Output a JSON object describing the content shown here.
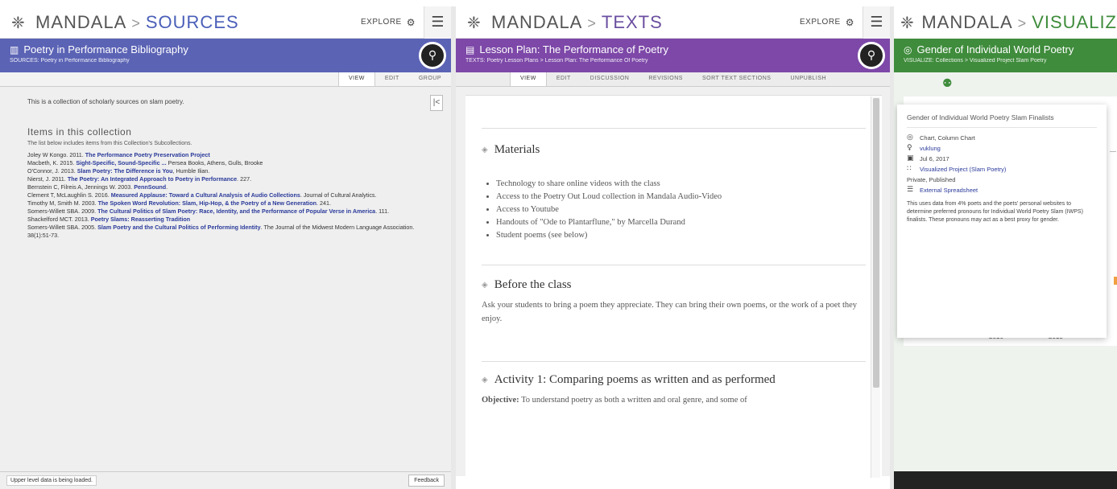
{
  "sources": {
    "brand": "MANDALA",
    "section": "SOURCES",
    "explore": "EXPLORE",
    "title": "Poetry in Performance Bibliography",
    "crumb": "SOURCES: Poetry in Performance Bibliography",
    "tabs": [
      "VIEW",
      "EDIT",
      "GROUP"
    ],
    "intro": "This is a collection of scholarly sources on slam poetry.",
    "items_heading": "Items in this collection",
    "items_sub": "The list below includes items from this Collection's Subcollections.",
    "items": [
      {
        "pre": "Joley W Kongo. 2011. ",
        "bold": "The Performance Poetry Preservation Project",
        "post": ""
      },
      {
        "pre": "Macbeth, K. 2015. ",
        "bold": "Sight-Specific, Sound-Specific ...",
        "post": " Persea Books, Athens, Gulls, Brooke"
      },
      {
        "pre": "O'Connor, J. 2013. ",
        "bold": "Slam Poetry: The Difference is You",
        "post": ", Humble Ilian."
      },
      {
        "pre": "Nierst, J. 2011. ",
        "bold": "The Poetry: An Integrated Approach to Poetry in Performance",
        "post": ". 227."
      },
      {
        "pre": "Bernstein C, Filreis A, Jennings W. 2003. ",
        "bold": "PennSound",
        "post": "."
      },
      {
        "pre": "Clement T, McLaughlin S. 2016. ",
        "bold": "Measured Applause: Toward a Cultural Analysis of Audio Collections",
        "post": ". Journal of Cultural Analytics."
      },
      {
        "pre": "Timothy M, Smith M. 2003. ",
        "bold": "The Spoken Word Revolution: Slam, Hip-Hop, & the Poetry of a New Generation",
        "post": ". 241."
      },
      {
        "pre": "Somers-Willett SBA. 2009. ",
        "bold": "The Cultural Politics of Slam Poetry: Race, Identity, and the Performance of Popular Verse in America",
        "post": ". 111."
      },
      {
        "pre": "Shackelford MCT. 2013. ",
        "bold": "Poetry Slams: Reasserting Tradition",
        "post": ""
      },
      {
        "pre": "Somers-Willett SBA. 2005. ",
        "bold": "Slam Poetry and the Cultural Politics of Performing Identity",
        "post": ". The Journal of the Midwest Modern Language Association. 38(1):51-73."
      }
    ],
    "footer_msg": "Upper level data is being loaded.",
    "footer_btn": "Feedback"
  },
  "texts": {
    "brand": "MANDALA",
    "section": "TEXTS",
    "explore": "EXPLORE",
    "title": "Lesson Plan: The Performance of Poetry",
    "crumb": "TEXTS: Poetry Lesson Plans > Lesson Plan: The Performance Of Poetry",
    "tabs": [
      "VIEW",
      "EDIT",
      "DISCUSSION",
      "REVISIONS",
      "SORT TEXT SECTIONS",
      "UNPUBLISH"
    ],
    "materials_heading": "Materials",
    "materials": [
      "Technology to share online videos with the class",
      "Access to the Poetry Out Loud collection in Mandala Audio-Video",
      "Access to Youtube",
      "Handouts of \"Ode to Plantarflune,\" by Marcella Durand",
      "Student poems (see below)"
    ],
    "before_heading": "Before the class",
    "before_text": "Ask your students to bring a poem they appreciate. They can bring their own poems, or the work of a poet they enjoy.",
    "activity_heading": "Activity 1: Comparing poems as written and as performed",
    "objective_label": "Objective:",
    "objective_text": " To understand poetry as both a written and oral genre, and some of"
  },
  "visualize": {
    "brand": "MANDALA",
    "section": "VISUALIZ",
    "title": "Gender of Individual World Poetry",
    "crumb": "VISUALIZE: Collections > Visualized Project Slam Poetry",
    "card_title": "Gender of Individual World Poetry Slam Finalists",
    "rows": [
      {
        "icon": "◎",
        "text": "Chart, Column Chart",
        "link": false
      },
      {
        "icon": "♀",
        "text": "vuklung",
        "link": true
      },
      {
        "icon": "▣",
        "text": "Jul 6, 2017",
        "link": false
      },
      {
        "icon": "∷",
        "text": "Visualized Project (Slam Poetry)",
        "link": true
      },
      {
        "icon": "",
        "text": "Private, Published",
        "link": false
      },
      {
        "icon": "☰",
        "text": "External Spreadsheet",
        "link": true
      }
    ],
    "desc": "This uses data from 4% poets and the poets' personal websites to determine preferred pronouns for Individual World Poetry Slam (IWPS) finalists. These pronouns may act as a best proxy for gender.",
    "years": [
      "2016",
      "2015"
    ],
    "colors": {
      "orange": "#f0a040",
      "green": "#3f8c3c"
    }
  }
}
